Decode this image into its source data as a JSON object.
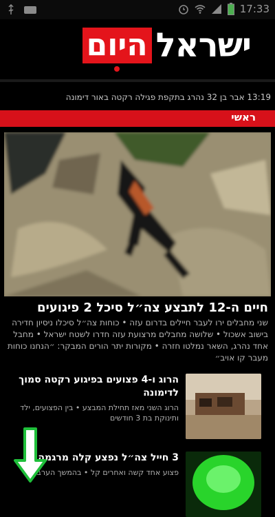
{
  "status_bar": {
    "time": "17:33",
    "icons": [
      "usb-icon",
      "message-icon",
      "alarm-icon",
      "wifi-icon",
      "signal-icon",
      "battery-icon"
    ]
  },
  "header": {
    "logo_main": "ישראל",
    "logo_badge": "היום",
    "logo_badge_color": "#e4141b"
  },
  "ticker": {
    "text": "13:19 אבר בן 32 נהרג בתקפת פגילה רקטה באור דימונה"
  },
  "section": {
    "label": "ראשי",
    "color": "#d7111a"
  },
  "main_story": {
    "headline": "חיים ה-12 לתבצע צה״ל סיכל 2 פיגועים",
    "summary": "שני מחבלים ירו לעבר חיילים בדרום עזה • כוחות צה״ל סיכלו ניסיון חדירה בישוב אשכול • שלושה מחבלים מרצועת עזה חדרו לשטח ישראל • מחבל אחד נהרג, השאר נמלטו חזרה • מקורות יתר הורים המבקר: ״הנחנו כוחות מעבר קו אויב״"
  },
  "articles": [
    {
      "title": "הרוג ו-4 פצועים בפיגוע רקטה סמוך לדימונה",
      "excerpt": "הרוג השני מאז תחילת המבצע • בין הפצועים, ילד ותינוקת בת 3 חודשים",
      "thumb": "building-ruins"
    },
    {
      "title": "3 חייל צה״ל נפצע קלה מרגמה",
      "excerpt": "פצוע אחד קשה ואחרים קל • בהמשך הערב",
      "thumb": "green-flare"
    }
  ],
  "scroll_hint": "down-arrow"
}
